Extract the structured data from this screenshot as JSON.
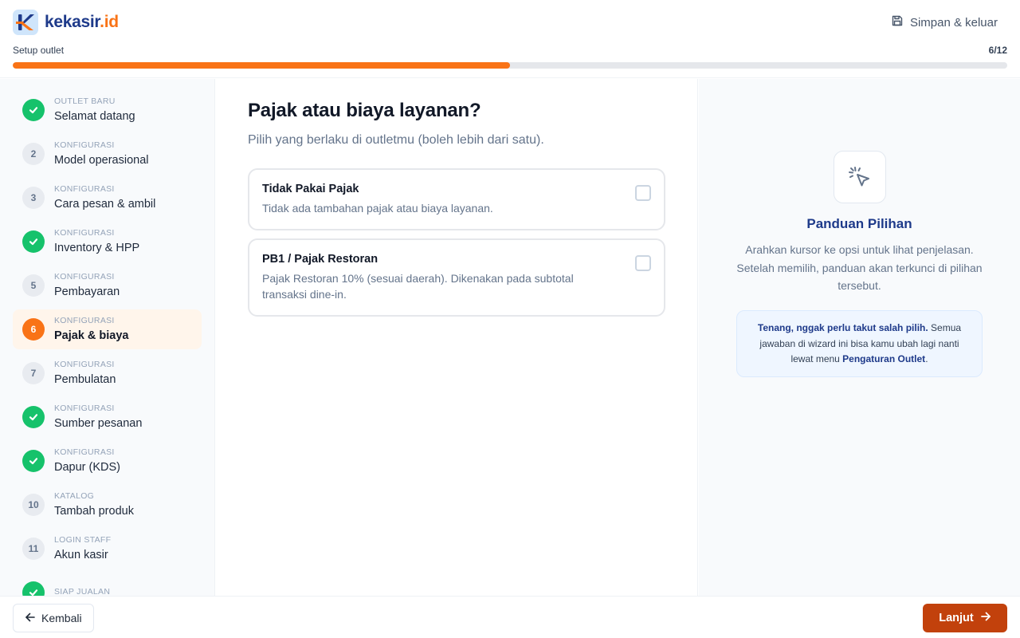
{
  "brand": {
    "name_main": "kekasir",
    "name_suffix": ".id",
    "logo_icon": "kekasir-logo-icon"
  },
  "header": {
    "save_exit_label": "Simpan & keluar",
    "save_exit_icon": "save-icon",
    "progress_label": "Setup outlet",
    "progress_count": "6/12",
    "progress_fraction": 0.5,
    "accent_color": "#f97316"
  },
  "steps": [
    {
      "number": "1",
      "category": "OUTLET BARU",
      "title": "Selamat datang",
      "status": "done"
    },
    {
      "number": "2",
      "category": "KONFIGURASI",
      "title": "Model operasional",
      "status": "todo"
    },
    {
      "number": "3",
      "category": "KONFIGURASI",
      "title": "Cara pesan & ambil",
      "status": "todo"
    },
    {
      "number": "4",
      "category": "KONFIGURASI",
      "title": "Inventory & HPP",
      "status": "done"
    },
    {
      "number": "5",
      "category": "KONFIGURASI",
      "title": "Pembayaran",
      "status": "todo"
    },
    {
      "number": "6",
      "category": "KONFIGURASI",
      "title": "Pajak & biaya",
      "status": "current"
    },
    {
      "number": "7",
      "category": "KONFIGURASI",
      "title": "Pembulatan",
      "status": "todo"
    },
    {
      "number": "8",
      "category": "KONFIGURASI",
      "title": "Sumber pesanan",
      "status": "done"
    },
    {
      "number": "9",
      "category": "KONFIGURASI",
      "title": "Dapur (KDS)",
      "status": "done"
    },
    {
      "number": "10",
      "category": "KATALOG",
      "title": "Tambah produk",
      "status": "todo"
    },
    {
      "number": "11",
      "category": "LOGIN STAFF",
      "title": "Akun kasir",
      "status": "todo"
    },
    {
      "number": "12",
      "category": "SIAP JUALAN",
      "title": "",
      "status": "done"
    }
  ],
  "main": {
    "title": "Pajak atau biaya layanan?",
    "subtitle": "Pilih yang berlaku di outletmu (boleh lebih dari satu).",
    "options": [
      {
        "title": "Tidak Pakai Pajak",
        "description": "Tidak ada tambahan pajak atau biaya layanan.",
        "checked": false
      },
      {
        "title": "PB1 / Pajak Restoran",
        "description": "Pajak Restoran 10% (sesuai daerah). Dikenakan pada subtotal transaksi dine-in.",
        "checked": false
      }
    ]
  },
  "guide": {
    "icon": "cursor-click-icon",
    "title": "Panduan Pilihan",
    "description": "Arahkan kursor ke opsi untuk lihat penjelasan. Setelah memilih, panduan akan terkunci di pilihan tersebut.",
    "note_bold": "Tenang, nggak perlu takut salah pilih.",
    "note_text": " Semua jawaban di wizard ini bisa kamu ubah lagi nanti lewat menu ",
    "note_link": "Pengaturan Outlet",
    "note_end": "."
  },
  "footer": {
    "back_label": "Kembali",
    "back_icon": "arrow-left-icon",
    "next_label": "Lanjut",
    "next_icon": "arrow-right-icon",
    "next_color": "#c2410c"
  }
}
